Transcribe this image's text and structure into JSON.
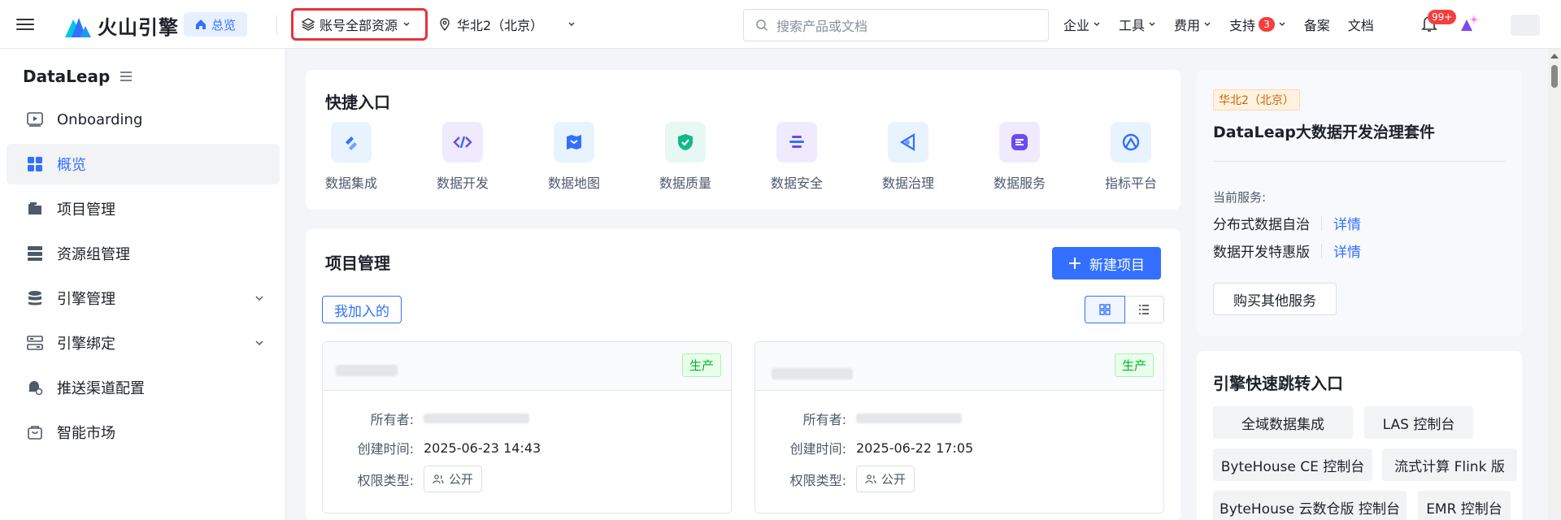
{
  "header": {
    "logo_text": "火山引擎",
    "home_label": "总览",
    "resource_scope": "账号全部资源",
    "region": "华北2（北京）",
    "search_placeholder": "搜索产品或文档",
    "nav": [
      {
        "label": "企业",
        "has_caret": true
      },
      {
        "label": "工具",
        "has_caret": true
      },
      {
        "label": "费用",
        "has_caret": true
      },
      {
        "label": "支持",
        "has_caret": true,
        "badge": "3"
      },
      {
        "label": "备案",
        "has_caret": false
      },
      {
        "label": "文档",
        "has_caret": false
      }
    ],
    "notification_badge": "99+"
  },
  "sidebar": {
    "title": "DataLeap",
    "items": [
      {
        "label": "Onboarding",
        "icon": "play-icon"
      },
      {
        "label": "概览",
        "icon": "grid-icon",
        "active": true
      },
      {
        "label": "项目管理",
        "icon": "folder-icon"
      },
      {
        "label": "资源组管理",
        "icon": "server-icon"
      },
      {
        "label": "引擎管理",
        "icon": "database-icon",
        "expandable": true
      },
      {
        "label": "引擎绑定",
        "icon": "link-icon",
        "expandable": true
      },
      {
        "label": "推送渠道配置",
        "icon": "bell-gear-icon"
      },
      {
        "label": "智能市场",
        "icon": "bag-icon"
      }
    ]
  },
  "quick_entry": {
    "title": "快捷入口",
    "items": [
      {
        "label": "数据集成",
        "icon": "integration-icon",
        "bg": "#e8f3ff",
        "fg": "#3370ff"
      },
      {
        "label": "数据开发",
        "icon": "code-icon",
        "bg": "#efeafe",
        "fg": "#6a4bf0"
      },
      {
        "label": "数据地图",
        "icon": "map-icon",
        "bg": "#e8f3ff",
        "fg": "#3370ff"
      },
      {
        "label": "数据质量",
        "icon": "shield-check-icon",
        "bg": "#e6f8f3",
        "fg": "#14b889"
      },
      {
        "label": "数据安全",
        "icon": "security-icon",
        "bg": "#efeafe",
        "fg": "#6a4bf0"
      },
      {
        "label": "数据治理",
        "icon": "governance-icon",
        "bg": "#e8f3ff",
        "fg": "#3370ff"
      },
      {
        "label": "数据服务",
        "icon": "service-icon",
        "bg": "#efeafe",
        "fg": "#6a4bf0"
      },
      {
        "label": "指标平台",
        "icon": "metric-icon",
        "bg": "#e8f3ff",
        "fg": "#3370ff"
      }
    ]
  },
  "projects": {
    "title": "项目管理",
    "new_button": "新建项目",
    "tab_joined": "我加入的",
    "cards": [
      {
        "env": "生产",
        "owner_label": "所有者:",
        "created_label": "创建时间:",
        "created": "2025-06-23 14:43",
        "perm_label": "权限类型:",
        "perm": "公开"
      },
      {
        "env": "生产",
        "owner_label": "所有者:",
        "created_label": "创建时间:",
        "created": "2025-06-22 17:05",
        "perm_label": "权限类型:",
        "perm": "公开"
      }
    ]
  },
  "product_info": {
    "region_tag": "华北2（北京）",
    "title": "DataLeap大数据开发治理套件",
    "current_label": "当前服务:",
    "services": [
      {
        "name": "分布式数据自治",
        "link": "详情"
      },
      {
        "name": "数据开发特惠版",
        "link": "详情"
      }
    ],
    "buy_button": "购买其他服务"
  },
  "engine_jump": {
    "title": "引擎快速跳转入口",
    "buttons": [
      "全域数据集成",
      "LAS 控制台",
      "ByteHouse CE 控制台",
      "流式计算 Flink 版",
      "ByteHouse 云数仓版 控制台",
      "EMR 控制台"
    ]
  }
}
